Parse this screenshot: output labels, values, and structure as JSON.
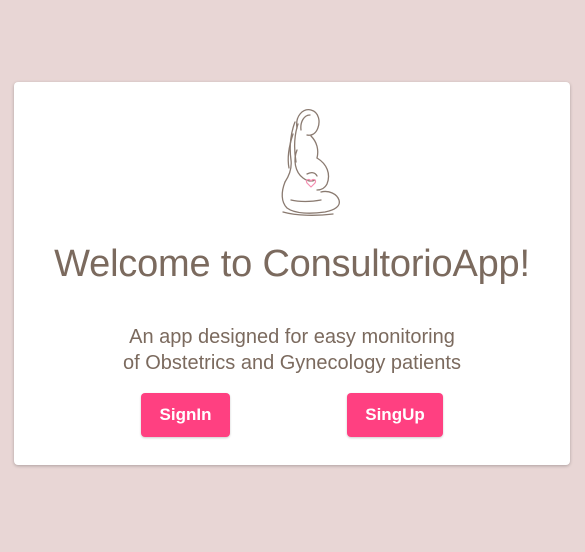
{
  "page": {
    "title": "Welcome to ConsultorioApp!",
    "subtitle_line1": "An app designed for easy monitoring",
    "subtitle_line2": "of Obstetrics and Gynecology patients",
    "logo_icon": "pregnant-woman-icon"
  },
  "actions": {
    "signin_label": "SignIn",
    "signup_label": "SingUp"
  },
  "colors": {
    "background": "#e8d6d5",
    "card": "#ffffff",
    "text": "#7b6a5e",
    "button": "#ff4081",
    "button_text": "#ffffff",
    "heart_accent": "#f48fb1"
  }
}
